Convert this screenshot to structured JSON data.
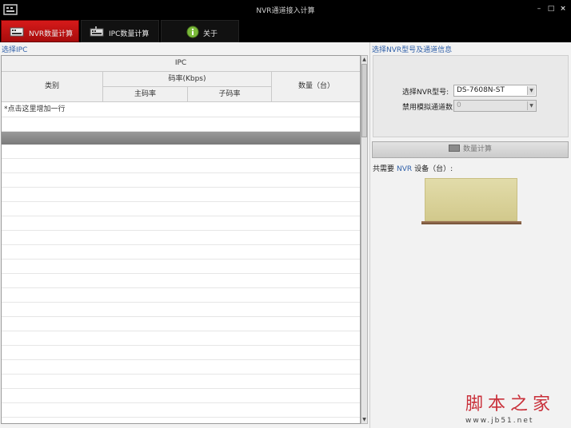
{
  "window": {
    "title": "NVR通道接入计算",
    "min": "–",
    "max": "□",
    "close": "×"
  },
  "tabs": [
    {
      "label": "NVR数量计算",
      "active": true,
      "icon": "nvr-device-icon"
    },
    {
      "label": "IPC数量计算",
      "active": false,
      "icon": "ipc-device-icon"
    },
    {
      "label": "关于",
      "active": false,
      "icon": "info-icon"
    }
  ],
  "left": {
    "section_title": "选择IPC",
    "table": {
      "header_ipc": "IPC",
      "col_type": "类别",
      "col_bitrate": "码率(Kbps)",
      "col_main": "主码率",
      "col_sub": "子码率",
      "col_count": "数量（台）"
    },
    "add_row": "*点击这里增加一行"
  },
  "right": {
    "section_title": "选择NVR型号及通道信息",
    "nvr_model_label": "选择NVR型号:",
    "nvr_model_value": "DS-7608N-ST",
    "disable_analog_label": "禁用模拟通道数:",
    "disable_analog_value": "0",
    "calc_button": "数量计算",
    "result_prefix": "共需要",
    "result_nvr": "NVR",
    "result_suffix": "设备（台）:"
  },
  "watermark": {
    "big": "脚本之家",
    "small": "www.jb51.net"
  },
  "colors": {
    "accent_red": "#c41212",
    "link_blue": "#2f5fa8"
  }
}
